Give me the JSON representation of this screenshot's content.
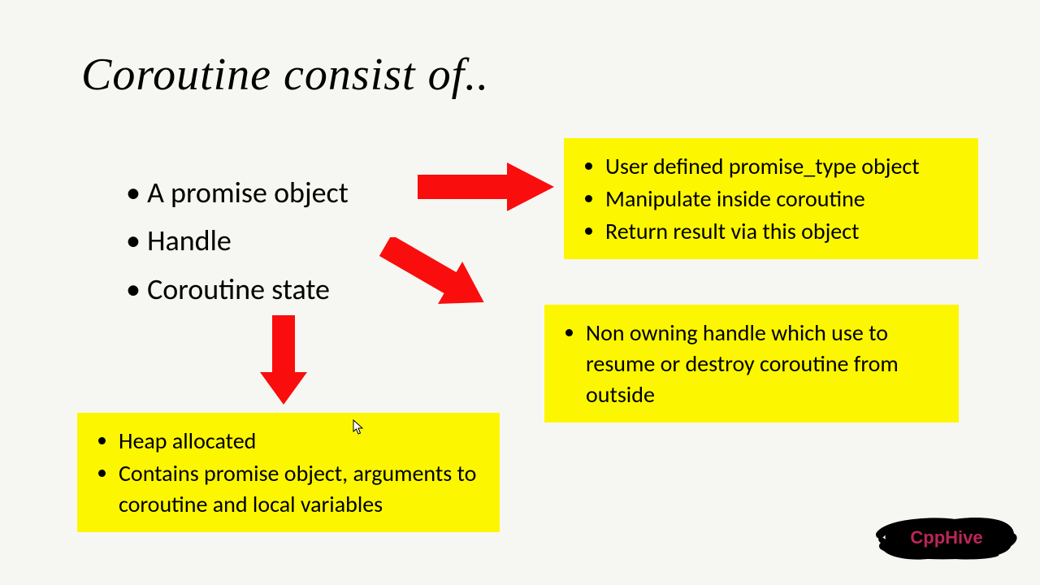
{
  "title": "Coroutine consist of..",
  "main": {
    "items": [
      "A promise object",
      "Handle",
      "Coroutine state"
    ]
  },
  "boxes": {
    "promise": {
      "bullets": [
        "User defined promise_type object",
        "Manipulate inside coroutine",
        "Return result via this object"
      ]
    },
    "handle": {
      "bullets": [
        "Non owning handle which use to resume or destroy coroutine from outside"
      ]
    },
    "state": {
      "bullets": [
        "Heap allocated",
        "Contains promise object, arguments to coroutine and local variables"
      ]
    }
  },
  "brand": "CppHive",
  "colors": {
    "arrow": "#fa0d0d",
    "box_bg": "#FCF700",
    "brand_text": "#bb2659"
  }
}
